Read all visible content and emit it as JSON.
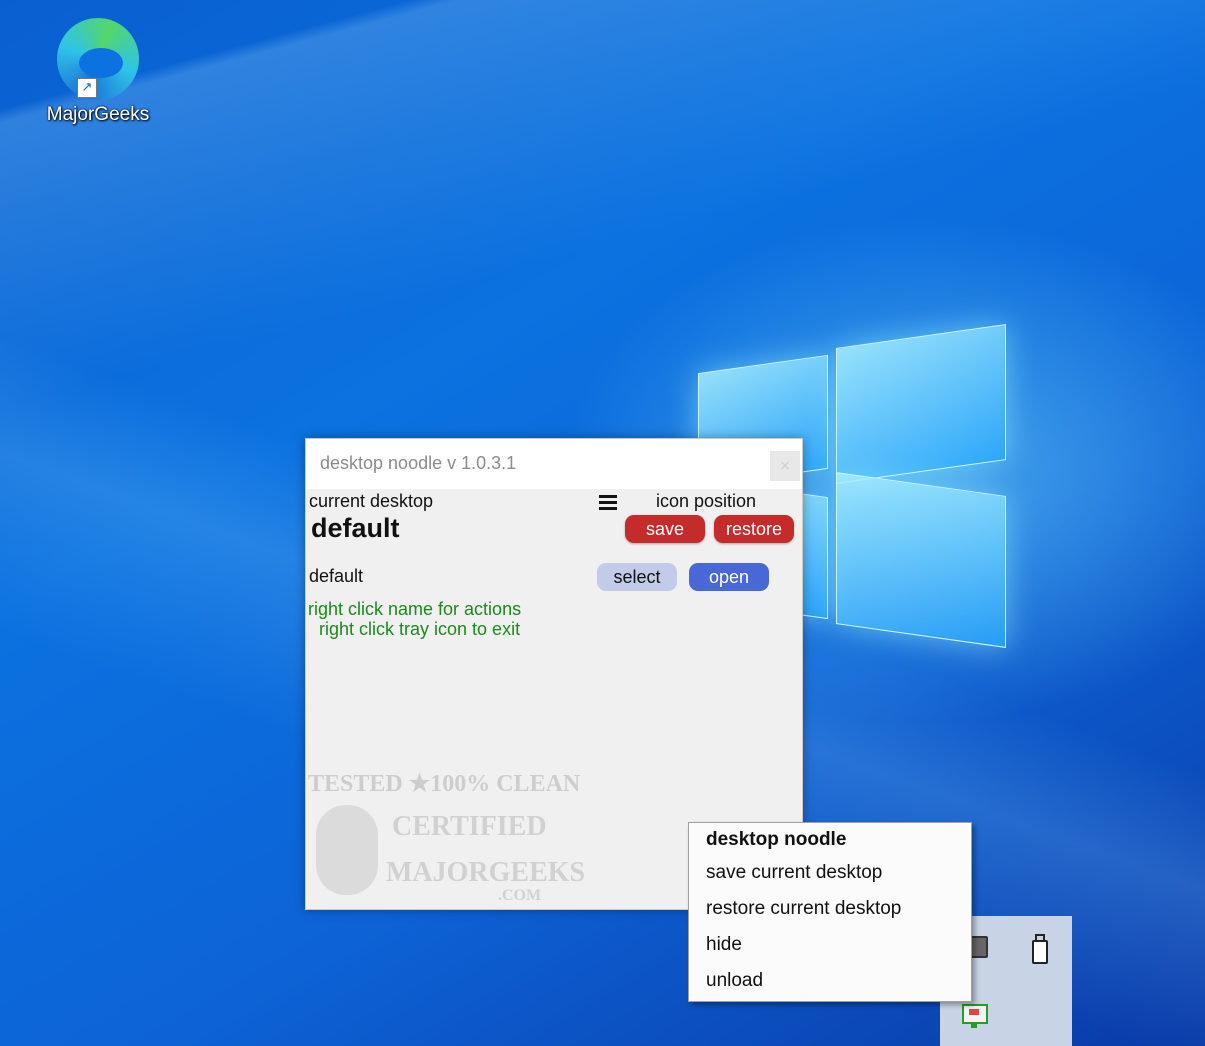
{
  "desktop": {
    "icons": [
      {
        "label": "MajorGeeks",
        "icon": "edge-browser-icon"
      }
    ]
  },
  "app": {
    "title": "desktop noodle v 1.0.3.1",
    "close_label": "×",
    "current_desktop_label": "current desktop",
    "current_desktop_name": "default",
    "icon_position_label": "icon position",
    "save_label": "save",
    "restore_label": "restore",
    "desktops": [
      {
        "name": "default",
        "select_label": "select",
        "open_label": "open"
      }
    ],
    "hint_1": "right click name for actions",
    "hint_2": "right click tray icon to exit",
    "watermark": {
      "top": "TESTED ★100% CLEAN",
      "middle": "CERTIFIED",
      "bottom": "MAJORGEEKS",
      "suffix": ".COM"
    },
    "colors": {
      "danger": "#c62b2b",
      "primary": "#4868d8",
      "secondary": "#c2cbe8",
      "hint": "#1c8a1c"
    }
  },
  "context_menu": {
    "title": "desktop noodle",
    "items": [
      "save current desktop",
      "restore current desktop",
      "hide",
      "unload"
    ]
  },
  "tray": {
    "icons": [
      "tray-app-icon",
      "usb-drive-icon",
      "desktop-noodle-tray-icon"
    ]
  }
}
